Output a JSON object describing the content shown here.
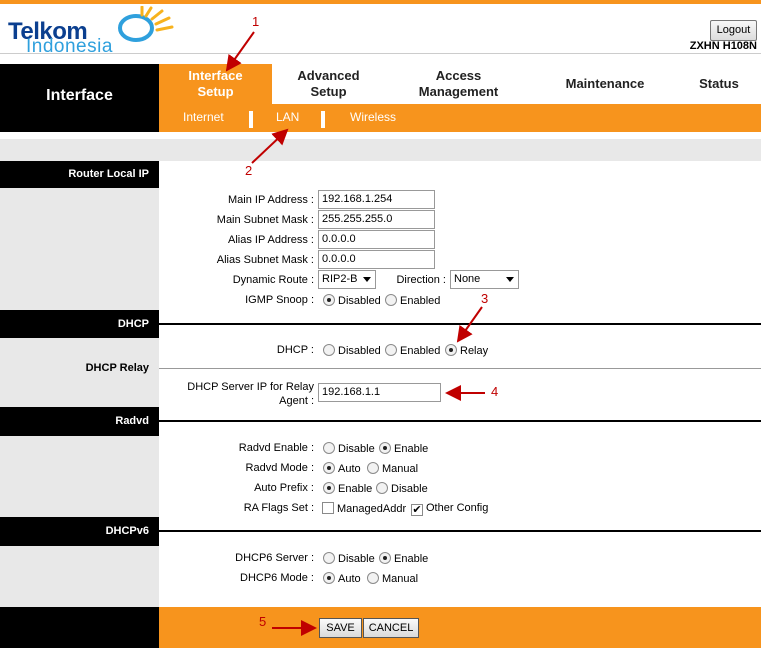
{
  "header": {
    "logo_line1": "Telkom",
    "logo_line2": "Indonesia",
    "logout_label": "Logout",
    "model": "ZXHN H108N"
  },
  "nav": {
    "section_title": "Interface",
    "tabs": [
      {
        "line1": "Interface",
        "line2": "Setup",
        "active": true
      },
      {
        "line1": "Advanced",
        "line2": "Setup",
        "active": false
      },
      {
        "line1": "Access",
        "line2": "Management",
        "active": false
      },
      {
        "line1": "Maintenance",
        "line2": "",
        "active": false
      },
      {
        "line1": "Status",
        "line2": "",
        "active": false
      }
    ],
    "subtabs": [
      "Internet",
      "LAN",
      "Wireless"
    ]
  },
  "router_local_ip": {
    "title": "Router Local IP",
    "main_ip_label": "Main IP Address :",
    "main_ip": "192.168.1.254",
    "main_mask_label": "Main Subnet Mask :",
    "main_mask": "255.255.255.0",
    "alias_ip_label": "Alias IP Address :",
    "alias_ip": "0.0.0.0",
    "alias_mask_label": "Alias Subnet Mask :",
    "alias_mask": "0.0.0.0",
    "dynamic_route_label": "Dynamic Route :",
    "dynamic_route": "RIP2-B",
    "direction_label": "Direction :",
    "direction": "None",
    "igmp_label": "IGMP Snoop :",
    "igmp_options": [
      "Disabled",
      "Enabled"
    ],
    "igmp_selected": "Disabled"
  },
  "dhcp": {
    "title": "DHCP",
    "dhcp_label": "DHCP :",
    "options": [
      "Disabled",
      "Enabled",
      "Relay"
    ],
    "selected": "Relay",
    "relay_title": "DHCP Relay",
    "server_ip_label_line1": "DHCP Server IP for Relay",
    "server_ip_label_line2": "Agent :",
    "server_ip": "192.168.1.1"
  },
  "radvd": {
    "title": "Radvd",
    "enable_label": "Radvd Enable :",
    "enable_options": [
      "Disable",
      "Enable"
    ],
    "enable_selected": "Enable",
    "mode_label": "Radvd Mode :",
    "mode_options": [
      "Auto",
      "Manual"
    ],
    "mode_selected": "Auto",
    "prefix_label": "Auto Prefix :",
    "prefix_options": [
      "Enable",
      "Disable"
    ],
    "prefix_selected": "Enable",
    "ra_flags_label": "RA Flags Set :",
    "ra_managed": "ManagedAddr",
    "ra_managed_checked": false,
    "ra_other": "Other Config",
    "ra_other_checked": true
  },
  "dhcpv6": {
    "title": "DHCPv6",
    "server_label": "DHCP6 Server :",
    "server_options": [
      "Disable",
      "Enable"
    ],
    "server_selected": "Enable",
    "mode_label": "DHCP6 Mode :",
    "mode_options": [
      "Auto",
      "Manual"
    ],
    "mode_selected": "Auto"
  },
  "footer": {
    "save_label": "SAVE",
    "cancel_label": "CANCEL"
  },
  "annotations": [
    "1",
    "2",
    "3",
    "4",
    "5"
  ],
  "colors": {
    "accent": "#f7941d",
    "annotation": "#c00000",
    "section_bg": "#000000",
    "gray_bg": "#e8e8e8"
  }
}
